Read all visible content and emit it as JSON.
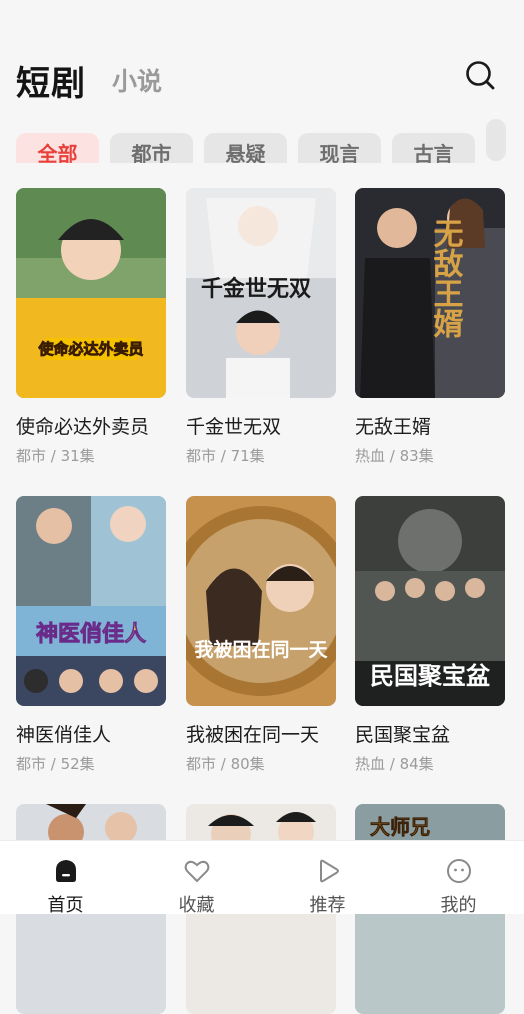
{
  "header": {
    "tabs": [
      {
        "label": "短剧"
      },
      {
        "label": "小说"
      }
    ]
  },
  "categories": [
    {
      "label": "全部",
      "active": true
    },
    {
      "label": "都市"
    },
    {
      "label": "悬疑"
    },
    {
      "label": "现言"
    },
    {
      "label": "古言"
    }
  ],
  "dramas": [
    {
      "title": "使命必达外卖员",
      "meta": "都市 / 31集",
      "poster_text": "使命必达外卖员"
    },
    {
      "title": "千金世无双",
      "meta": "都市 / 71集",
      "poster_text": "千金世无双"
    },
    {
      "title": "无敌王婿",
      "meta": "热血 / 83集",
      "poster_text": "无敌王婿"
    },
    {
      "title": "神医俏佳人",
      "meta": "都市 / 52集",
      "poster_text": "神医俏佳人"
    },
    {
      "title": "我被困在同一天",
      "meta": "都市 / 80集",
      "poster_text": "我被困在同一天"
    },
    {
      "title": "民国聚宝盆",
      "meta": "热血 / 84集",
      "poster_text": "民国聚宝盆"
    },
    {
      "poster_text": ""
    },
    {
      "poster_text": ""
    },
    {
      "poster_text": "大师兄"
    }
  ],
  "tabbar": [
    {
      "label": "首页",
      "icon": "home-icon",
      "active": true
    },
    {
      "label": "收藏",
      "icon": "heart-icon"
    },
    {
      "label": "推荐",
      "icon": "play-icon"
    },
    {
      "label": "我的",
      "icon": "profile-icon"
    }
  ],
  "colors": {
    "accent": "#e8403b",
    "chip_active_bg": "#fde2e2",
    "chip_bg": "#e6e6e6"
  }
}
